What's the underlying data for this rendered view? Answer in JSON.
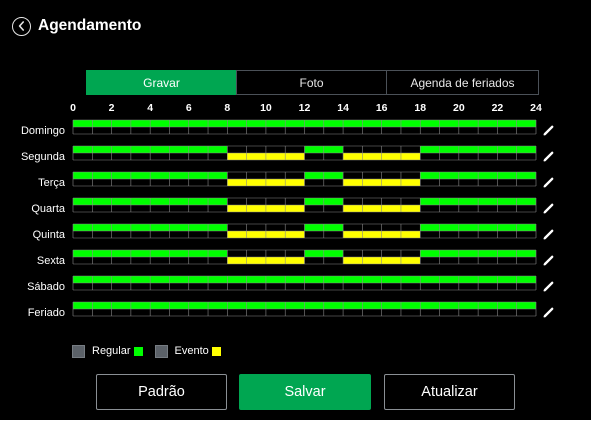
{
  "header": {
    "title": "Agendamento"
  },
  "tabs": [
    {
      "label": "Gravar",
      "active": true
    },
    {
      "label": "Foto",
      "active": false
    },
    {
      "label": "Agenda de feriados",
      "active": false
    }
  ],
  "hour_labels": [
    "0",
    "2",
    "4",
    "6",
    "8",
    "10",
    "12",
    "14",
    "16",
    "18",
    "20",
    "22",
    "24"
  ],
  "days": [
    {
      "label": "Domingo",
      "regular": [
        [
          0,
          24
        ]
      ],
      "event": []
    },
    {
      "label": "Segunda",
      "regular": [
        [
          0,
          8
        ],
        [
          12,
          14
        ],
        [
          18,
          24
        ]
      ],
      "event": [
        [
          8,
          12
        ],
        [
          14,
          18
        ]
      ]
    },
    {
      "label": "Terça",
      "regular": [
        [
          0,
          8
        ],
        [
          12,
          14
        ],
        [
          18,
          24
        ]
      ],
      "event": [
        [
          8,
          12
        ],
        [
          14,
          18
        ]
      ]
    },
    {
      "label": "Quarta",
      "regular": [
        [
          0,
          8
        ],
        [
          12,
          14
        ],
        [
          18,
          24
        ]
      ],
      "event": [
        [
          8,
          12
        ],
        [
          14,
          18
        ]
      ]
    },
    {
      "label": "Quinta",
      "regular": [
        [
          0,
          8
        ],
        [
          12,
          14
        ],
        [
          18,
          24
        ]
      ],
      "event": [
        [
          8,
          12
        ],
        [
          14,
          18
        ]
      ]
    },
    {
      "label": "Sexta",
      "regular": [
        [
          0,
          8
        ],
        [
          12,
          14
        ],
        [
          18,
          24
        ]
      ],
      "event": [
        [
          8,
          12
        ],
        [
          14,
          18
        ]
      ]
    },
    {
      "label": "Sábado",
      "regular": [
        [
          0,
          24
        ]
      ],
      "event": []
    },
    {
      "label": "Feriado",
      "regular": [
        [
          0,
          24
        ]
      ],
      "event": []
    }
  ],
  "legend": {
    "regular_label": "Regular",
    "event_label": "Evento"
  },
  "buttons": {
    "default_label": "Padrão",
    "save_label": "Salvar",
    "refresh_label": "Atualizar"
  },
  "colors": {
    "regular": "#00ff00",
    "event": "#ffff00",
    "accent": "#00a651",
    "background": "#000000"
  }
}
